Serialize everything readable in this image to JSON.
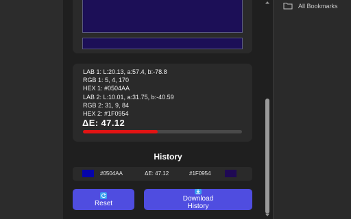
{
  "bookmarks": {
    "label": "All Bookmarks",
    "icon": "folder-icon"
  },
  "colors": {
    "color1": "#0504AA",
    "color2": "#1F0954",
    "accent": "#4F4DE0",
    "delta_bar": "#E31313"
  },
  "info": {
    "lab1": "LAB 1: L:20.13, a:57.4, b:-78.8",
    "rgb1": "RGB 1: 5, 4, 170",
    "hex1": "HEX 1: #0504AA",
    "lab2": "LAB 2: L:10.01, a:31.75, b:-40.59",
    "rgb2": "RGB 2: 31, 9, 84",
    "hex2": "HEX 2: #1F0954"
  },
  "delta": {
    "label": "ΔE: 47.12",
    "value": 47.12,
    "fill_fraction": 0.47
  },
  "history": {
    "title": "History",
    "entries": [
      {
        "hex1": "#0504AA",
        "delta": "ΔE: 47.12",
        "hex2": "#1F0954"
      }
    ]
  },
  "buttons": {
    "reset": "Reset",
    "download_line1": "Download",
    "download_line2": "History"
  }
}
